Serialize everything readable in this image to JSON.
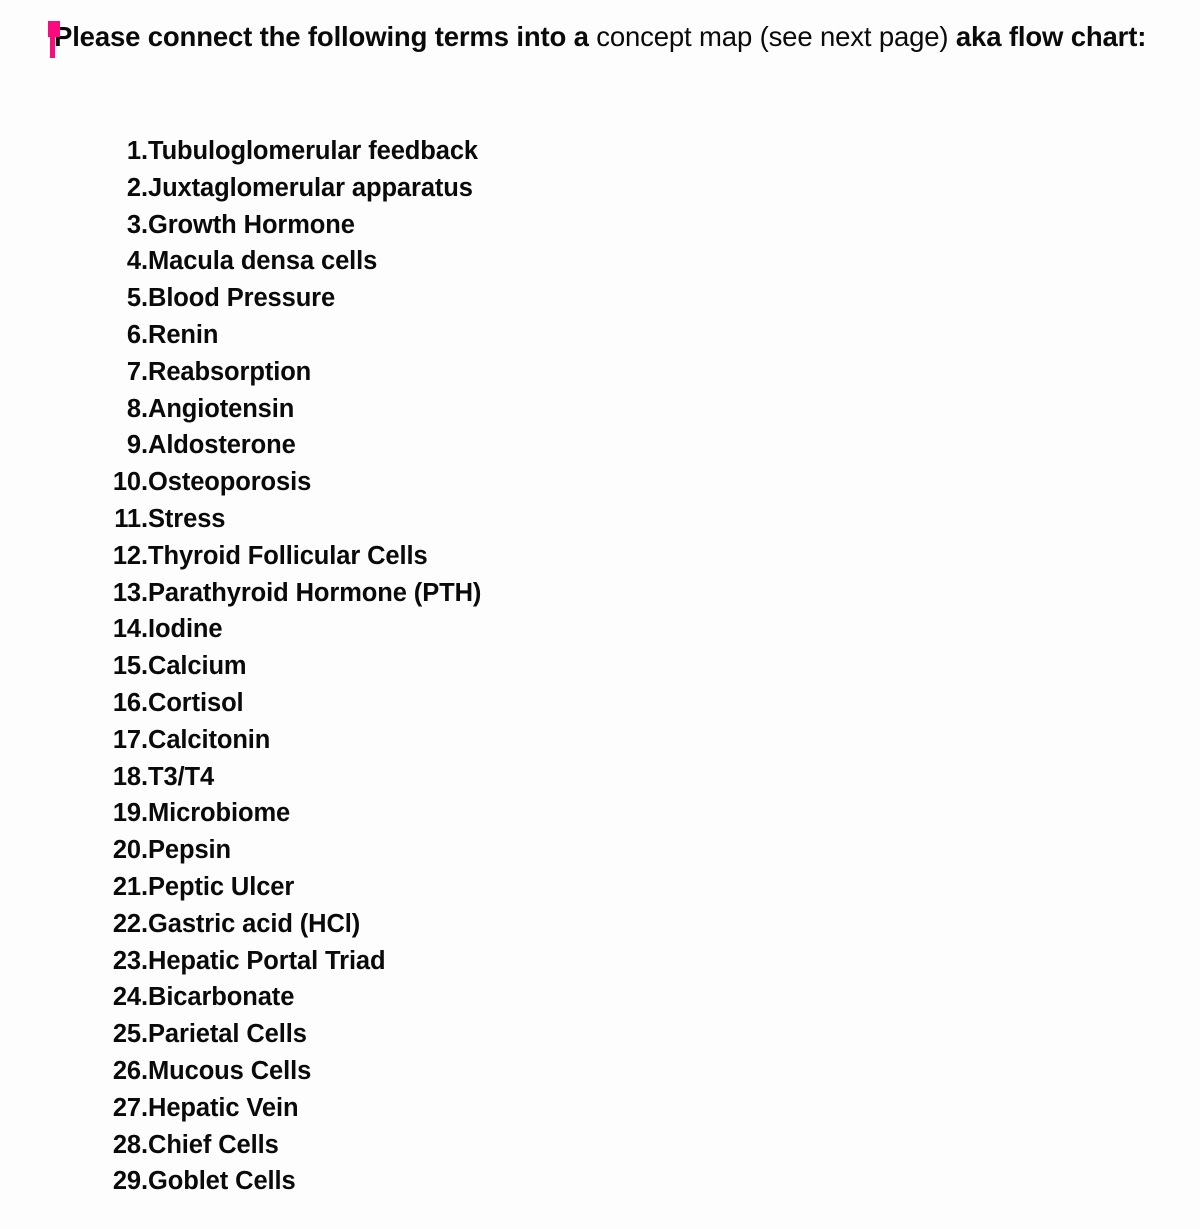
{
  "accent_color": "#fa0a7e",
  "background_color": "#fdfdfd",
  "text_color": "#0a0a0a",
  "heading": {
    "segment_1_bold": "Please connect the following terms into a ",
    "segment_2_regular": "concept map (see next page) ",
    "segment_3_bold": "aka flow chart:",
    "full_text": "Please connect the following terms into a concept map (see next page) aka flow chart:"
  },
  "cursor_marker": {
    "name": "text-cursor-flag",
    "color": "#fa0a7e"
  },
  "list": {
    "items": [
      {
        "number": "1.",
        "label": "Tubuloglomerular feedback"
      },
      {
        "number": "2.",
        "label": "Juxtaglomerular apparatus"
      },
      {
        "number": "3.",
        "label": "Growth Hormone"
      },
      {
        "number": "4.",
        "label": "Macula densa cells"
      },
      {
        "number": "5.",
        "label": "Blood Pressure"
      },
      {
        "number": "6.",
        "label": "Renin"
      },
      {
        "number": "7.",
        "label": "Reabsorption"
      },
      {
        "number": "8.",
        "label": "Angiotensin"
      },
      {
        "number": "9.",
        "label": "Aldosterone"
      },
      {
        "number": "10.",
        "label": "Osteoporosis"
      },
      {
        "number": "11.",
        "label": "Stress"
      },
      {
        "number": "12.",
        "label": "Thyroid Follicular Cells"
      },
      {
        "number": "13.",
        "label": "Parathyroid Hormone (PTH)"
      },
      {
        "number": "14.",
        "label": "Iodine"
      },
      {
        "number": "15.",
        "label": "Calcium"
      },
      {
        "number": "16.",
        "label": "Cortisol"
      },
      {
        "number": "17.",
        "label": "Calcitonin"
      },
      {
        "number": "18.",
        "label": "T3/T4"
      },
      {
        "number": "19.",
        "label": "Microbiome"
      },
      {
        "number": "20.",
        "label": "Pepsin"
      },
      {
        "number": "21.",
        "label": "Peptic Ulcer"
      },
      {
        "number": "22.",
        "label": "Gastric acid (HCl)"
      },
      {
        "number": "23.",
        "label": "Hepatic Portal Triad"
      },
      {
        "number": "24.",
        "label": "Bicarbonate"
      },
      {
        "number": "25.",
        "label": "Parietal Cells"
      },
      {
        "number": "26.",
        "label": "Mucous Cells"
      },
      {
        "number": "27.",
        "label": "Hepatic Vein"
      },
      {
        "number": "28.",
        "label": "Chief Cells"
      },
      {
        "number": "29.",
        "label": "Goblet Cells"
      }
    ]
  }
}
